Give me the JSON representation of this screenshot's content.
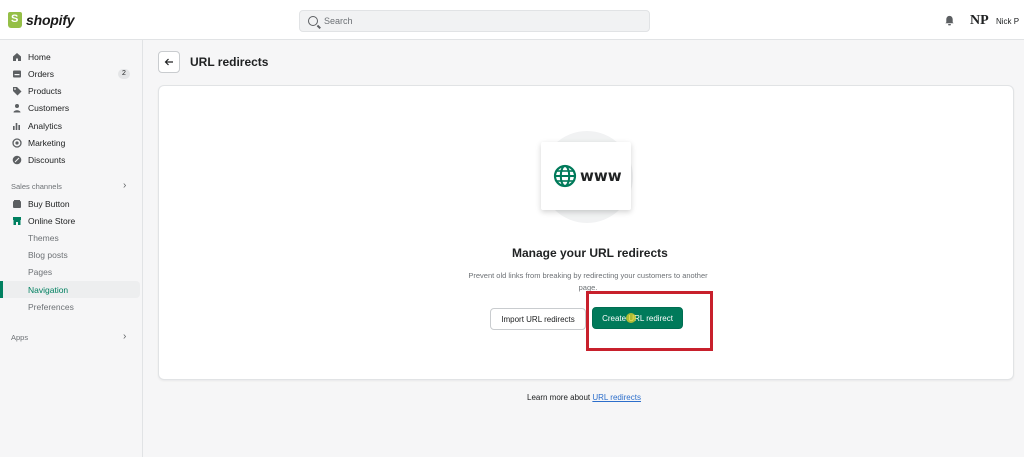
{
  "brand": {
    "name": "shopify"
  },
  "search": {
    "placeholder": "Search"
  },
  "user": {
    "initials": "NP",
    "name": "Nick P"
  },
  "sidebar": {
    "main_items": [
      {
        "label": "Home",
        "icon": "home-icon"
      },
      {
        "label": "Orders",
        "icon": "orders-icon",
        "badge": "2"
      },
      {
        "label": "Products",
        "icon": "tag-icon"
      },
      {
        "label": "Customers",
        "icon": "person-icon"
      },
      {
        "label": "Analytics",
        "icon": "bar-chart-icon"
      },
      {
        "label": "Marketing",
        "icon": "target-icon"
      },
      {
        "label": "Discounts",
        "icon": "discount-icon"
      }
    ],
    "sales_channels_label": "Sales channels",
    "channels": [
      {
        "label": "Buy Button",
        "icon": "buy-button-icon"
      },
      {
        "label": "Online Store",
        "icon": "store-icon"
      }
    ],
    "online_store_sub": [
      {
        "label": "Themes"
      },
      {
        "label": "Blog posts"
      },
      {
        "label": "Pages"
      },
      {
        "label": "Navigation",
        "active": true
      },
      {
        "label": "Preferences"
      }
    ],
    "apps_label": "Apps"
  },
  "page": {
    "title": "URL redirects"
  },
  "empty_state": {
    "illustration_text": "www",
    "title": "Manage your URL redirects",
    "description": "Prevent old links from breaking by redirecting your customers to another page.",
    "secondary_action": "Import URL redirects",
    "primary_action": "Create URL redirect"
  },
  "footer": {
    "prefix": "Learn more about ",
    "link": "URL redirects"
  },
  "colors": {
    "primary": "#007a5a",
    "active": "#008060",
    "highlight": "#c8202c",
    "link": "#2c6ecb"
  }
}
